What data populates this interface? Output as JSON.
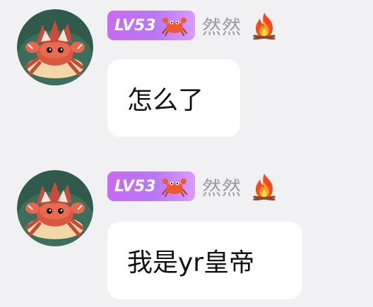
{
  "messages": [
    {
      "level": "LV53",
      "username": "然然",
      "text": "怎么了",
      "avatar_icon": "crab-character-avatar",
      "badge_icon": "crab-icon",
      "status_icon": "fire-icon"
    },
    {
      "level": "LV53",
      "username": "然然",
      "text": "我是yr皇帝",
      "avatar_icon": "crab-character-avatar",
      "badge_icon": "crab-icon",
      "status_icon": "fire-icon"
    }
  ],
  "colors": {
    "background": "#f1f1f3",
    "bubble": "#ffffff",
    "badge_gradient_start": "#c86af2",
    "badge_gradient_end": "#d99cfa",
    "username": "#9b9b9b",
    "message_text": "#111111"
  }
}
